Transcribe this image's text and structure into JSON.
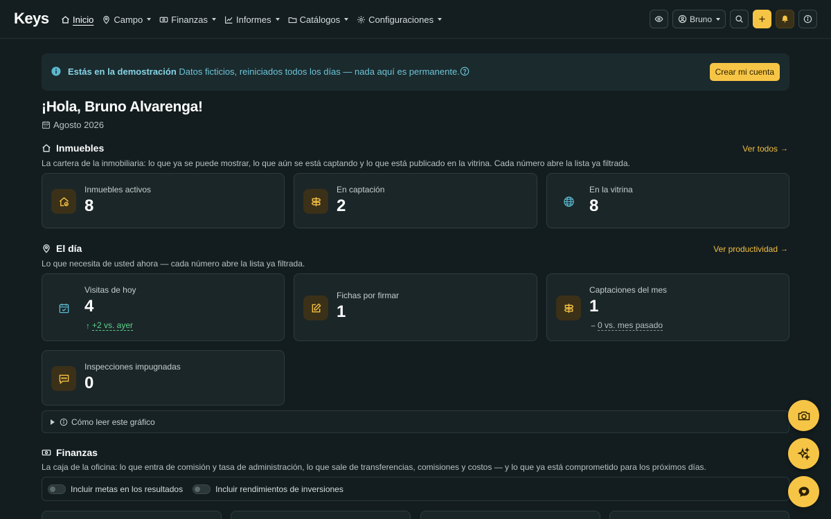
{
  "app": {
    "logo": "Keys"
  },
  "nav": {
    "items": [
      {
        "label": "Inicio",
        "icon": "home-icon",
        "active": true
      },
      {
        "label": "Campo",
        "icon": "map-pin-icon"
      },
      {
        "label": "Finanzas",
        "icon": "cash-icon"
      },
      {
        "label": "Informes",
        "icon": "chart-line-icon"
      },
      {
        "label": "Catálogos",
        "icon": "folder-icon"
      },
      {
        "label": "Configuraciones",
        "icon": "gear-icon"
      }
    ],
    "user_label": "Bruno"
  },
  "banner": {
    "title": "Estás en la demostración",
    "text": "Datos ficticios, reiniciados todos los días — nada aquí es permanente.",
    "cta": "Crear mi cuenta"
  },
  "greeting": {
    "title": "¡Hola, Bruno Alvarenga!",
    "date": "Agosto 2026"
  },
  "inmuebles": {
    "title": "Inmuebles",
    "description": "La cartera de la inmobiliaria: lo que ya se puede mostrar, lo que aún se está captando y lo que está publicado en la vitrina. Cada número abre la lista ya filtrada.",
    "link": "Ver todos",
    "cards": [
      {
        "label": "Inmuebles activos",
        "value": "8",
        "icon": "house-check-icon"
      },
      {
        "label": "En captación",
        "value": "2",
        "icon": "signpost-icon"
      },
      {
        "label": "En la vitrina",
        "value": "8",
        "icon": "globe-icon"
      }
    ]
  },
  "dia": {
    "title": "El día",
    "description": "Lo que necesita de usted ahora — cada número abre la lista ya filtrada.",
    "link": "Ver productividad",
    "cards": [
      {
        "label": "Visitas de hoy",
        "value": "4",
        "delta_symbol": "↑",
        "delta": "+2 vs. ayer",
        "icon": "calendar-check-icon"
      },
      {
        "label": "Fichas por firmar",
        "value": "1",
        "icon": "edit-icon"
      },
      {
        "label": "Captaciones del mes",
        "value": "1",
        "delta_symbol": "−",
        "delta": "0 vs. mes pasado",
        "icon": "signpost-icon"
      },
      {
        "label": "Inspecciones impugnadas",
        "value": "0",
        "icon": "chat-icon"
      }
    ],
    "howto": "Cómo leer este gráfico"
  },
  "finanzas": {
    "title": "Finanzas",
    "description": "La caja de la oficina: lo que entra de comisión y tasa de administración, lo que sale de transferencias, comisiones y costos — y lo que ya está comprometido para los próximos días.",
    "toggles": [
      {
        "label": "Incluir metas en los resultados",
        "on": false
      },
      {
        "label": "Incluir rendimientos de inversiones",
        "on": false
      }
    ]
  },
  "colors": {
    "accent": "#f7c546",
    "background": "#131d1f",
    "card": "#1b2628",
    "info": "#6cc4d8",
    "positive": "#5fd08c"
  }
}
